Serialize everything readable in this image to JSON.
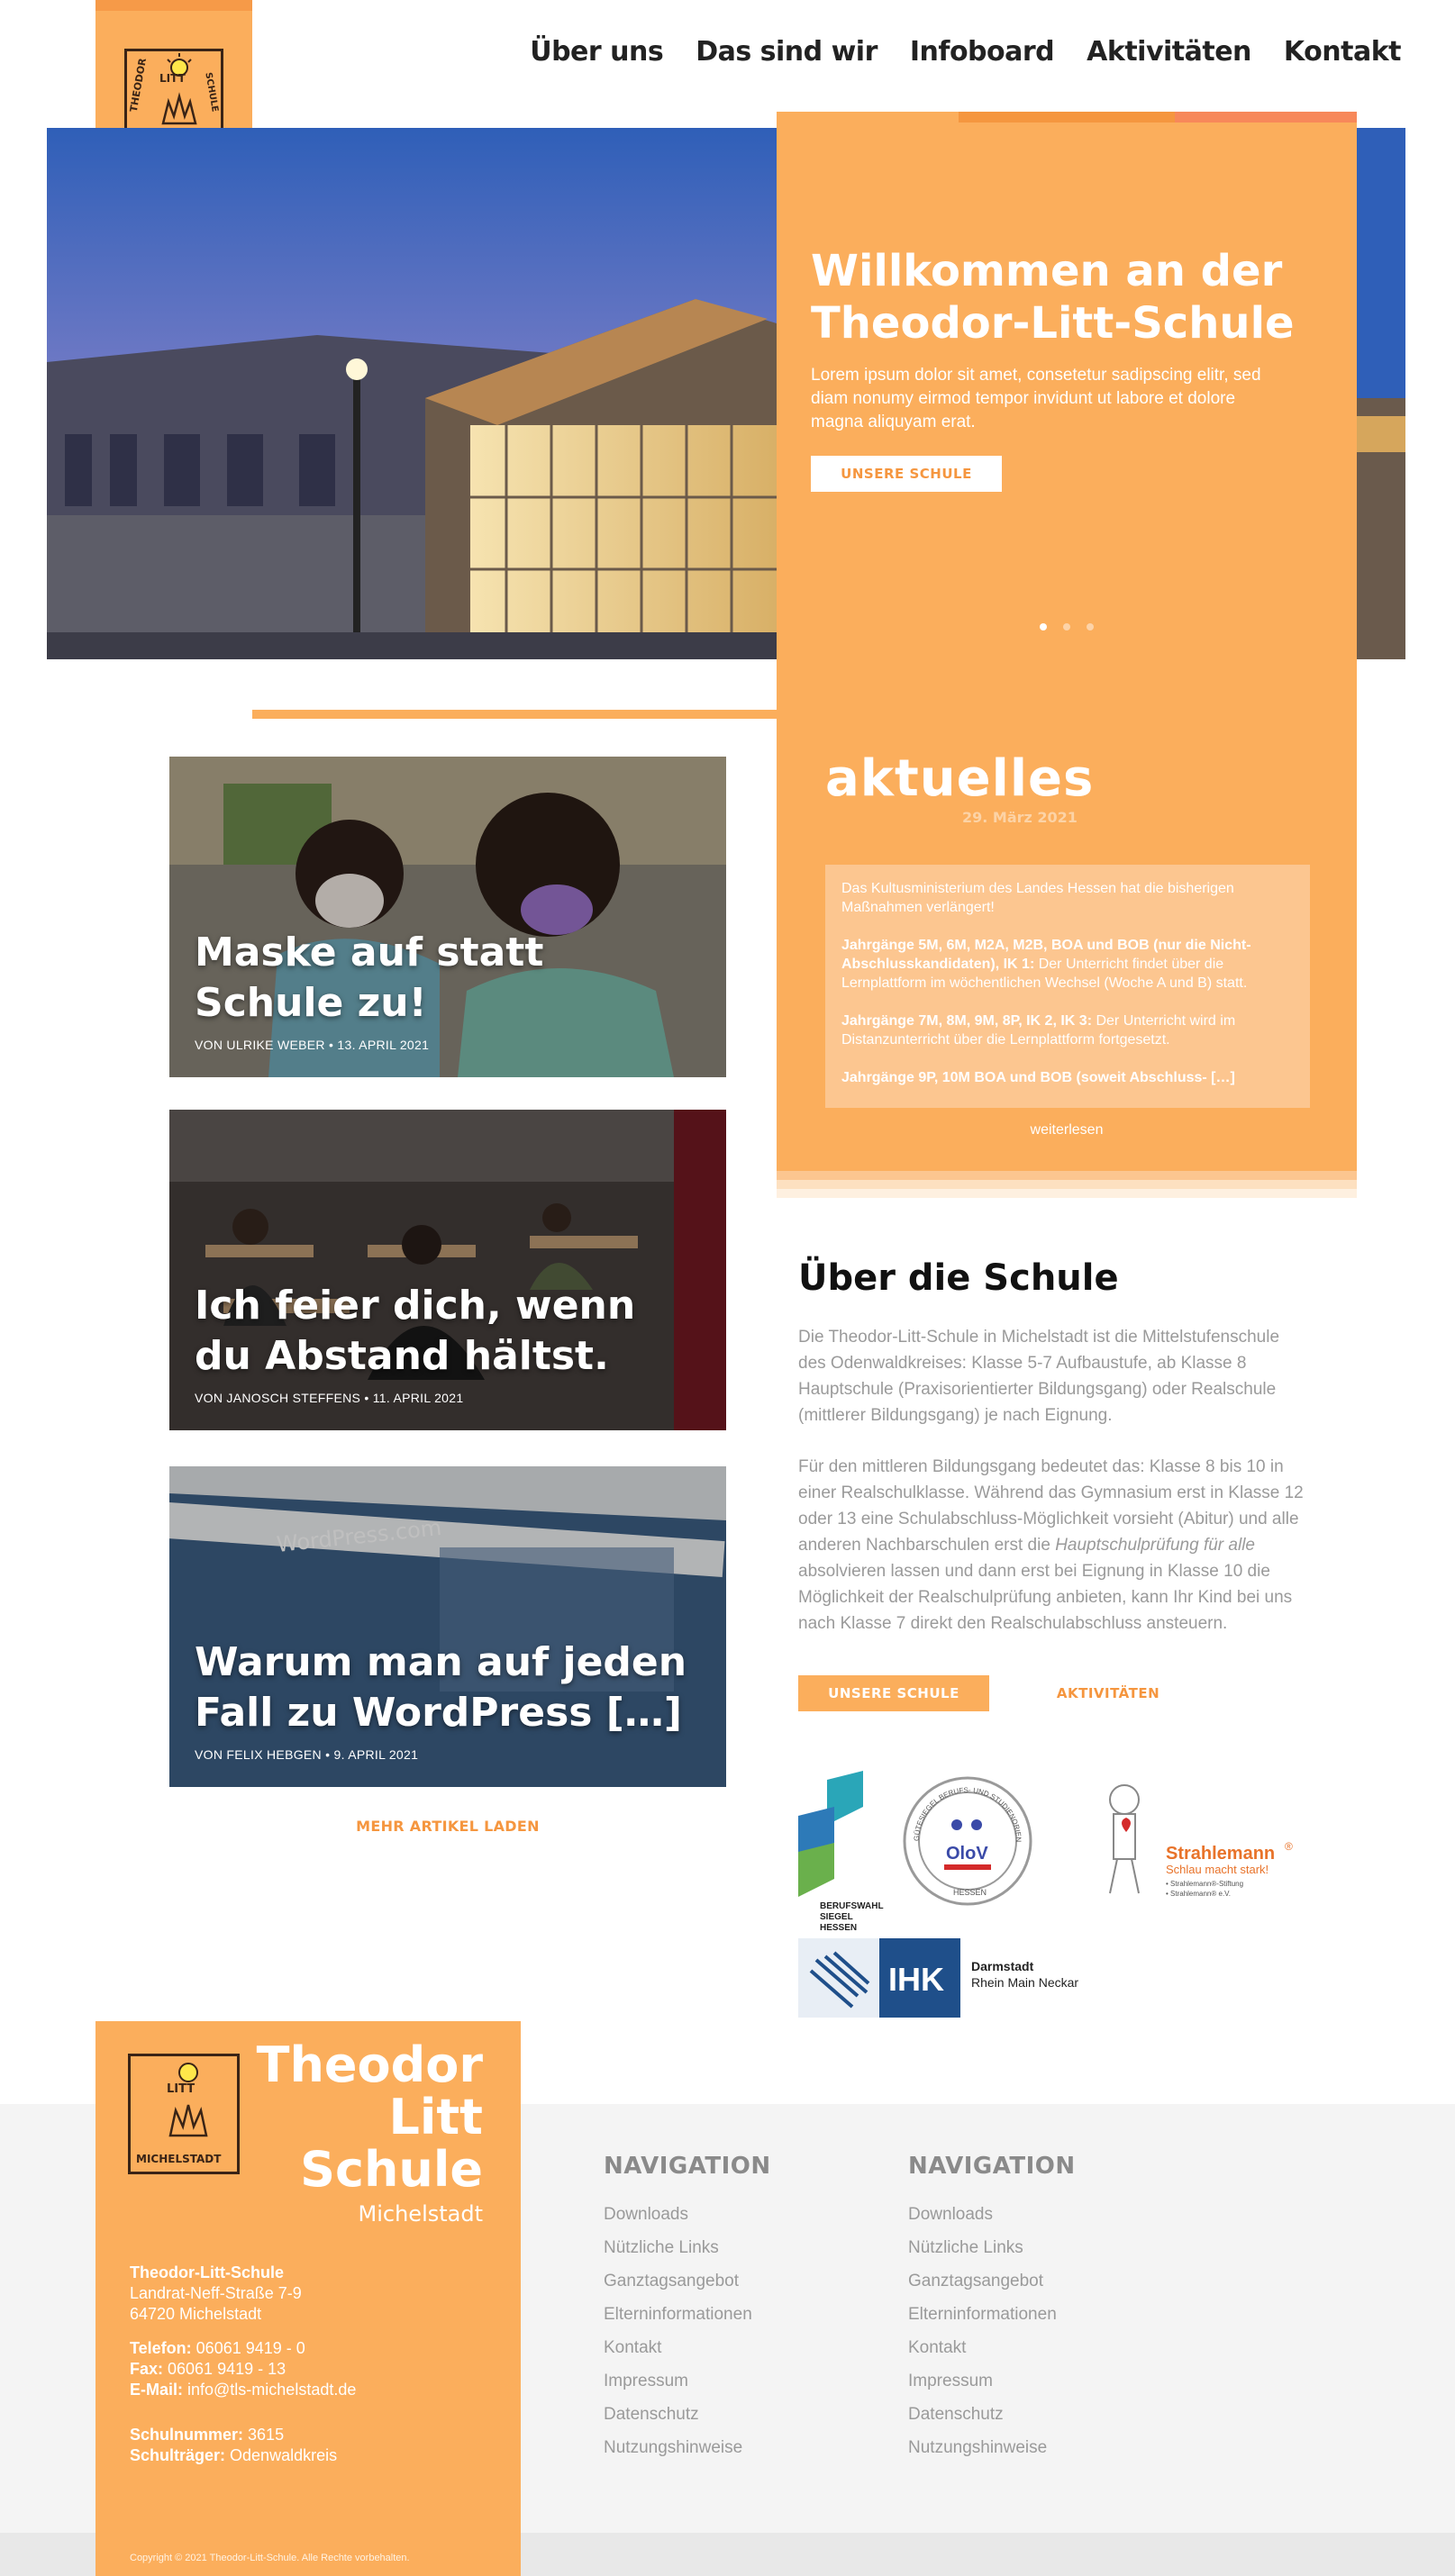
{
  "header": {
    "nav": [
      "Über uns",
      "Das sind wir",
      "Infoboard",
      "Aktivitäten",
      "Kontakt"
    ]
  },
  "hero": {
    "title": "Willkommen an der Theodor-Litt-Schule",
    "text": "Lorem ipsum dolor sit amet, consetetur sadipscing elitr, sed diam nonumy eirmod tempor invidunt ut labore et dolore magna aliquyam erat.",
    "button": "UNSERE SCHULE",
    "slides": 3,
    "active_slide": 1
  },
  "news": {
    "title": "aktuelles",
    "date": "29. März 2021",
    "intro": "Das Kultusministerium des Landes Hessen hat die bisherigen Maßnahmen verlängert!",
    "item1_bold": "Jahrgänge 5M, 6M, M2A, M2B, BOA und BOB (nur die Nicht-Abschlusskandidaten), IK 1:",
    "item1_text": " Der Unterricht findet über die Lernplattform im wöchentlichen Wechsel (Woche A und B) statt.",
    "item2_bold": "Jahrgänge 7M, 8M, 9M, 8P, IK 2, IK 3:",
    "item2_text": " Der Unterricht wird im Distanzunterricht über die Lernplattform fortgesetzt.",
    "item3_bold": "Jahrgänge 9P, 10M BOA und BOB (soweit Abschluss- […]",
    "more": "weiterlesen"
  },
  "posts": [
    {
      "title": "Maske auf statt Schule zu!",
      "meta": "VON ULRIKE WEBER  •  13. APRIL 2021"
    },
    {
      "title": "Ich feier dich, wenn du Abstand hältst.",
      "meta": "VON JANOSCH STEFFENS  •  11. APRIL 2021"
    },
    {
      "title": "Warum man auf jeden Fall zu WordPress […]",
      "meta": "VON FELIX HEBGEN  •  9. APRIL 2021"
    }
  ],
  "more_posts": "MEHR ARTIKEL LADEN",
  "about": {
    "title": "Über die Schule",
    "p1": "Die Theodor-Litt-Schule in Michelstadt ist die Mittelstufenschule des Odenwaldkreises: Klasse 5-7 Aufbaustufe, ab Klasse 8 Hauptschule (Praxisorientierter Bildungsgang) oder Realschule (mittlerer Bildungsgang) je nach Eignung.",
    "p2a": "Für den mittleren Bildungsgang bedeutet das: Klasse 8 bis 10 in einer Realschulklasse. Während das Gymnasium erst in Klasse 12 oder 13 eine Schulabschluss-Möglichkeit vorsieht (Abitur) und alle anderen Nachbarschulen erst die ",
    "p2i": "Hauptschulprüfung für alle",
    "p2b": " absolvieren lassen und dann erst bei Eignung in Klasse 10 die Möglichkeit der Realschulprüfung anbieten, kann Ihr Kind bei uns nach Klasse 7 direkt den Realschulabschluss ansteuern.",
    "button1": "UNSERE SCHULE",
    "button2": "AKTIVITÄTEN"
  },
  "partners": {
    "siegel": [
      "BERUFSWAHL",
      "SIEGEL",
      "HESSEN"
    ],
    "olov_ring": "GÜTESIEGEL BERUFS- UND STUDIENORIENTIERUNG",
    "olov": "OloV",
    "olov_state": "HESSEN",
    "strahlemann": "Strahlemann",
    "strahlemann_reg": "®",
    "strahlemann_slogan": "Schlau macht stark!",
    "strahlemann_sub1": "• Strahlemann®-Stiftung",
    "strahlemann_sub2": "• Strahlemann® e.V.",
    "ihk": "IHK",
    "ihk_city1": "Darmstadt",
    "ihk_city2": "Rhein Main Neckar"
  },
  "footer": {
    "school_name_1": "Theodor",
    "school_name_2": "Litt",
    "school_name_3": "Schule",
    "city": "Michelstadt",
    "addr_name": "Theodor-Litt-Schule",
    "addr_street": "Landrat-Neff-Straße 7-9",
    "addr_city": "64720 Michelstadt",
    "tel_label": "Telefon:",
    "tel": " 06061 9419 - 0",
    "fax_label": "Fax:",
    "fax": " 06061 9419 - 13",
    "mail_label": "E-Mail:",
    "mail": " info@tls-michelstadt.de",
    "nr_label": "Schulnummer:",
    "nr": " 3615",
    "traeger_label": "Schulträger:",
    "traeger": " Odenwaldkreis",
    "copyright": "Copyright © 2021 Theodor-Litt-Schule. Alle Rechte vorbehalten.",
    "nav_col1_title": "NAVIGATION",
    "nav_col2_title": "NAVIGATION",
    "nav_links": [
      "Downloads",
      "Nützliche Links",
      "Ganztagsangebot",
      "Elterninformationen",
      "Kontakt",
      "Impressum",
      "Datenschutz",
      "Nutzungshinweise"
    ]
  },
  "logo": {
    "line1": "THEODOR",
    "line2": "LITT",
    "line3": "SCHULE",
    "line4": "MICHELSTADT"
  },
  "colors": {
    "brand_orange": "#fbae5c",
    "accent_orange": "#f5963f",
    "text_grey": "#9a9a9a"
  }
}
